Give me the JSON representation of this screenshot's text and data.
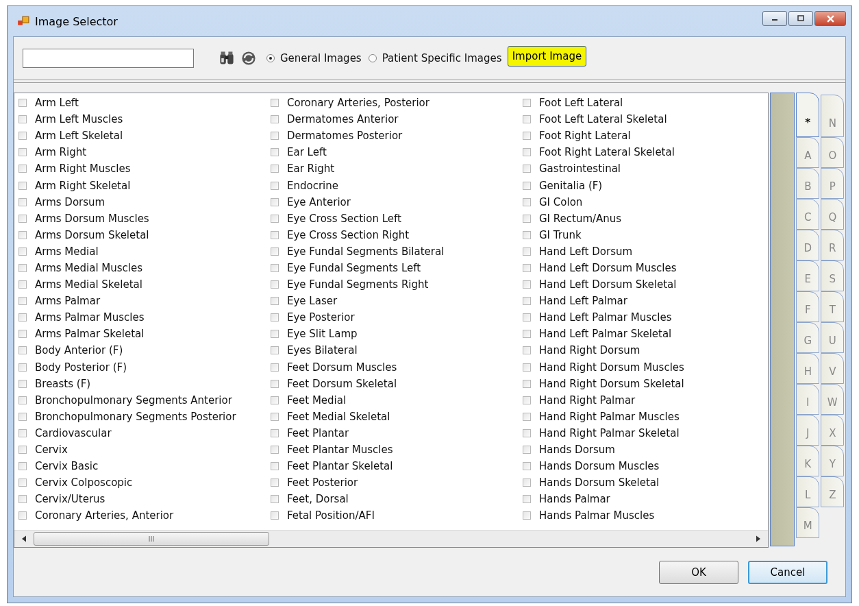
{
  "window": {
    "title": "Image Selector"
  },
  "toolbar": {
    "image_sources": [
      {
        "label": "General Images",
        "selected": true
      },
      {
        "label": "Patient Specific Images",
        "selected": false
      }
    ],
    "import_button": {
      "label": "Import Image",
      "highlighted": true
    }
  },
  "images": [
    {
      "label": "Arm Left",
      "checked": false
    },
    {
      "label": "Arm Left Muscles",
      "checked": false
    },
    {
      "label": "Arm Left Skeletal",
      "checked": false
    },
    {
      "label": "Arm Right",
      "checked": false
    },
    {
      "label": "Arm Right Muscles",
      "checked": false
    },
    {
      "label": "Arm Right Skeletal",
      "checked": false
    },
    {
      "label": "Arms Dorsum",
      "checked": false
    },
    {
      "label": "Arms Dorsum Muscles",
      "checked": false
    },
    {
      "label": "Arms Dorsum Skeletal",
      "checked": false
    },
    {
      "label": "Arms Medial",
      "checked": false
    },
    {
      "label": "Arms Medial Muscles",
      "checked": false
    },
    {
      "label": "Arms Medial Skeletal",
      "checked": false
    },
    {
      "label": "Arms Palmar",
      "checked": false
    },
    {
      "label": "Arms Palmar Muscles",
      "checked": false
    },
    {
      "label": "Arms Palmar Skeletal",
      "checked": false
    },
    {
      "label": "Body Anterior (F)",
      "checked": false
    },
    {
      "label": "Body Posterior (F)",
      "checked": false
    },
    {
      "label": "Breasts (F)",
      "checked": false
    },
    {
      "label": "Bronchopulmonary Segments Anterior",
      "checked": false
    },
    {
      "label": "Bronchopulmonary Segments Posterior",
      "checked": false
    },
    {
      "label": "Cardiovascular",
      "checked": false
    },
    {
      "label": "Cervix",
      "checked": false
    },
    {
      "label": "Cervix Basic",
      "checked": false
    },
    {
      "label": "Cervix Colposcopic",
      "checked": false
    },
    {
      "label": "Cervix/Uterus",
      "checked": false
    },
    {
      "label": "Coronary Arteries, Anterior",
      "checked": false
    },
    {
      "label": "Coronary Arteries, Posterior",
      "checked": false
    },
    {
      "label": "Dermatomes Anterior",
      "checked": false
    },
    {
      "label": "Dermatomes Posterior",
      "checked": false
    },
    {
      "label": "Ear Left",
      "checked": false
    },
    {
      "label": "Ear Right",
      "checked": false
    },
    {
      "label": "Endocrine",
      "checked": false
    },
    {
      "label": "Eye Anterior",
      "checked": false
    },
    {
      "label": "Eye Cross Section Left",
      "checked": false
    },
    {
      "label": "Eye Cross Section Right",
      "checked": false
    },
    {
      "label": "Eye Fundal Segments Bilateral",
      "checked": false
    },
    {
      "label": "Eye Fundal Segments Left",
      "checked": false
    },
    {
      "label": "Eye Fundal Segments Right",
      "checked": false
    },
    {
      "label": "Eye Laser",
      "checked": false
    },
    {
      "label": "Eye Posterior",
      "checked": false
    },
    {
      "label": "Eye Slit Lamp",
      "checked": false
    },
    {
      "label": "Eyes Bilateral",
      "checked": false
    },
    {
      "label": "Feet Dorsum Muscles",
      "checked": false
    },
    {
      "label": "Feet Dorsum Skeletal",
      "checked": false
    },
    {
      "label": "Feet Medial",
      "checked": false
    },
    {
      "label": "Feet Medial Skeletal",
      "checked": false
    },
    {
      "label": "Feet Plantar",
      "checked": false
    },
    {
      "label": "Feet Plantar Muscles",
      "checked": false
    },
    {
      "label": "Feet Plantar Skeletal",
      "checked": false
    },
    {
      "label": "Feet Posterior",
      "checked": false
    },
    {
      "label": "Feet, Dorsal",
      "checked": false
    },
    {
      "label": "Fetal Position/AFI",
      "checked": false
    },
    {
      "label": "Foot Left Lateral",
      "checked": false
    },
    {
      "label": "Foot Left Lateral Skeletal",
      "checked": false
    },
    {
      "label": "Foot Right Lateral",
      "checked": false
    },
    {
      "label": "Foot Right Lateral Skeletal",
      "checked": false
    },
    {
      "label": "Gastrointestinal",
      "checked": false
    },
    {
      "label": "Genitalia (F)",
      "checked": false
    },
    {
      "label": "GI Colon",
      "checked": false
    },
    {
      "label": "GI Rectum/Anus",
      "checked": false
    },
    {
      "label": "GI Trunk",
      "checked": false
    },
    {
      "label": "Hand Left Dorsum",
      "checked": false
    },
    {
      "label": "Hand Left Dorsum Muscles",
      "checked": false
    },
    {
      "label": "Hand Left Dorsum Skeletal",
      "checked": false
    },
    {
      "label": "Hand Left Palmar",
      "checked": false
    },
    {
      "label": "Hand Left Palmar Muscles",
      "checked": false
    },
    {
      "label": "Hand Left Palmar Skeletal",
      "checked": false
    },
    {
      "label": "Hand Right Dorsum",
      "checked": false
    },
    {
      "label": "Hand Right Dorsum Muscles",
      "checked": false
    },
    {
      "label": "Hand Right Dorsum Skeletal",
      "checked": false
    },
    {
      "label": "Hand Right Palmar",
      "checked": false
    },
    {
      "label": "Hand Right Palmar Muscles",
      "checked": false
    },
    {
      "label": "Hand Right Palmar Skeletal",
      "checked": false
    },
    {
      "label": "Hands Dorsum",
      "checked": false
    },
    {
      "label": "Hands Dorsum Muscles",
      "checked": false
    },
    {
      "label": "Hands Dorsum Skeletal",
      "checked": false
    },
    {
      "label": "Hands Palmar",
      "checked": false
    },
    {
      "label": "Hands Palmar Muscles",
      "checked": false
    }
  ],
  "index_tabs": [
    {
      "label": "*",
      "selected": true
    },
    {
      "label": "A",
      "selected": false
    },
    {
      "label": "B",
      "selected": false
    },
    {
      "label": "C",
      "selected": false
    },
    {
      "label": "D",
      "selected": false
    },
    {
      "label": "E",
      "selected": false
    },
    {
      "label": "F",
      "selected": false
    },
    {
      "label": "G",
      "selected": false
    },
    {
      "label": "H",
      "selected": false
    },
    {
      "label": "I",
      "selected": false
    },
    {
      "label": "J",
      "selected": false
    },
    {
      "label": "K",
      "selected": false
    },
    {
      "label": "L",
      "selected": false
    },
    {
      "label": "M",
      "selected": false
    },
    {
      "label": "N",
      "selected": false
    },
    {
      "label": "O",
      "selected": false
    },
    {
      "label": "P",
      "selected": false
    },
    {
      "label": "Q",
      "selected": false
    },
    {
      "label": "R",
      "selected": false
    },
    {
      "label": "S",
      "selected": false
    },
    {
      "label": "T",
      "selected": false
    },
    {
      "label": "U",
      "selected": false
    },
    {
      "label": "V",
      "selected": false
    },
    {
      "label": "W",
      "selected": false
    },
    {
      "label": "X",
      "selected": false
    },
    {
      "label": "Y",
      "selected": false
    },
    {
      "label": "Z",
      "selected": false
    }
  ],
  "buttons": [
    {
      "label": "OK",
      "focused": false
    },
    {
      "label": "Cancel",
      "focused": true
    }
  ]
}
